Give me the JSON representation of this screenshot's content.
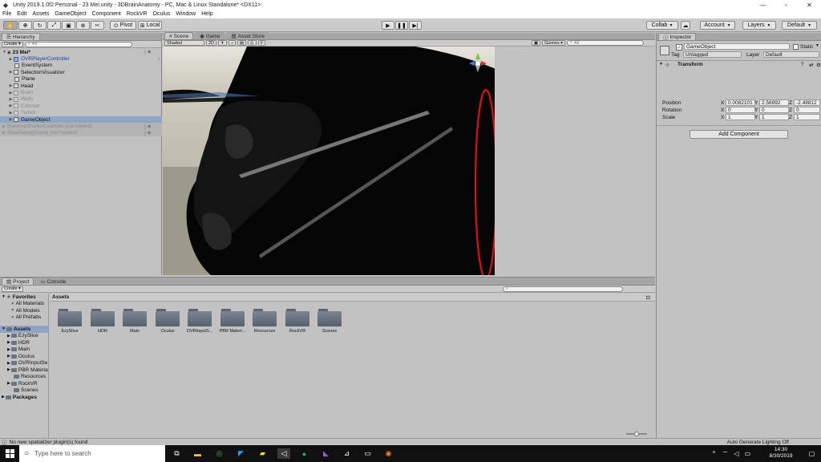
{
  "window": {
    "title": "Unity 2019.1.0f2 Personal - 23 Mei.unity - 3DBrainAnatomy - PC, Mac & Linux Standalone* <DX11>",
    "minimize": "—",
    "maximize": "▫",
    "close": "✕"
  },
  "menu": [
    "File",
    "Edit",
    "Assets",
    "GameObject",
    "Component",
    "RockVR",
    "Oculus",
    "Window",
    "Help"
  ],
  "toolbar": {
    "pivot": "Pivot",
    "local": "Local",
    "collab": "Collab",
    "account": "Account",
    "layers": "Layers",
    "layout": "Default"
  },
  "hierarchy": {
    "tab": "Hierarchy",
    "create": "Create",
    "search_placeholder": "All",
    "scene": "23 Mei*",
    "items": [
      {
        "name": "OVRPlayerController",
        "style": "blue"
      },
      {
        "name": "EventSystem",
        "style": "normal"
      },
      {
        "name": "SelectionVisualizer",
        "style": "normal"
      },
      {
        "name": "Plane",
        "style": "normal"
      },
      {
        "name": "Head",
        "style": "normal"
      },
      {
        "name": "Brain",
        "style": "muted"
      },
      {
        "name": "Walls",
        "style": "muted"
      },
      {
        "name": "Colored",
        "style": "muted"
      },
      {
        "name": "Tumor",
        "style": "muted"
      },
      {
        "name": "GameObject",
        "style": "selected"
      }
    ],
    "unloaded": [
      "RuntimeShatterExample (not loaded)",
      "SliceDebugScene (not loaded)"
    ]
  },
  "scene": {
    "tabs": [
      "Scene",
      "Game",
      "Asset Store"
    ],
    "shading": "Shaded",
    "mode_2d": "2D",
    "gizmos": "Gizmos",
    "search_placeholder": "All"
  },
  "inspector": {
    "tab": "Inspector",
    "object_name": "GameObject",
    "static_label": "Static",
    "tag_label": "Tag",
    "tag_value": "Untagged",
    "layer_label": "Layer",
    "layer_value": "Default",
    "component": "Transform",
    "position": {
      "label": "Position",
      "x": "0.0082101",
      "y": "2.56992",
      "z": "-2.48812"
    },
    "rotation": {
      "label": "Rotation",
      "x": "0",
      "y": "0",
      "z": "0"
    },
    "scale": {
      "label": "Scale",
      "x": "1",
      "y": "1",
      "z": "1"
    },
    "add_component": "Add Component"
  },
  "project": {
    "tabs": [
      "Project",
      "Console"
    ],
    "create": "Create",
    "favorites_label": "Favorites",
    "favorites": [
      "All Materials",
      "All Models",
      "All Prefabs"
    ],
    "assets_label": "Assets",
    "asset_tree": [
      "EzySlice",
      "HDR",
      "Main",
      "Oculus",
      "OVRInputSe",
      "PBR Materia",
      "Resources",
      "RockVR",
      "Scenes"
    ],
    "packages_label": "Packages",
    "breadcrumb": "Assets",
    "folders": [
      "EzySlice",
      "HDR",
      "Main",
      "Oculus",
      "OVRInputS...",
      "PBR Materi...",
      "Resources",
      "RockVR",
      "Scenes"
    ]
  },
  "status": {
    "message": "No new spatializer plugin(s) found",
    "lighting": "Auto Generate Lighting Off"
  },
  "taskbar": {
    "search_placeholder": "Type here to search",
    "time": "14:30",
    "date": "8/30/2019"
  },
  "colors": {
    "annotation": "#e01010",
    "selection": "#8ea5c8"
  }
}
